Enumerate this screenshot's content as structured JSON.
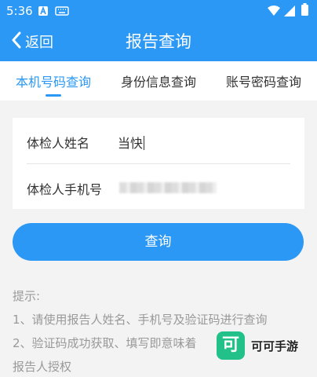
{
  "status_bar": {
    "time": "5:36",
    "icons": [
      "a-notification-icon",
      "keyboard-icon",
      "wifi-icon",
      "cellular-signal-icon",
      "battery-icon"
    ]
  },
  "header": {
    "back_label": "返回",
    "title": "报告查询"
  },
  "tabs": [
    {
      "label": "本机号码查询",
      "active": true
    },
    {
      "label": "身份信息查询",
      "active": false
    },
    {
      "label": "账号密码查询",
      "active": false
    }
  ],
  "form": {
    "name_label": "体检人姓名",
    "name_value": "当快",
    "phone_label": "体检人手机号"
  },
  "query_button": "查询",
  "tips": {
    "heading": "提示:",
    "line1": "1、请使用报告人姓名、手机号及验证码进行查询",
    "line2": "2、验证码成功获取、填写即意味着",
    "line3": "报告人授权"
  },
  "watermark": {
    "logo_char": "可",
    "text": "可可手游"
  },
  "colors": {
    "primary": "#2b98f5",
    "background": "#f3f3f3",
    "tip_text": "#999999",
    "watermark_green": "#23c18a"
  }
}
